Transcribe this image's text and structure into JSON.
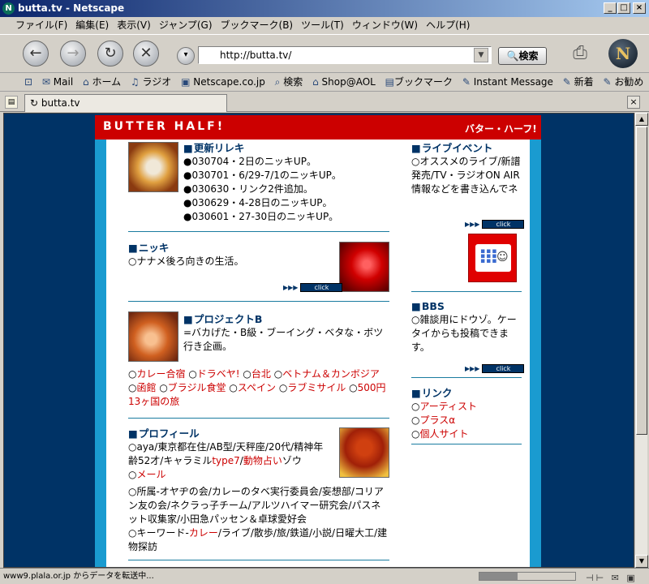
{
  "window": {
    "title": "butta.tv - Netscape",
    "app_icon": "N",
    "min": "_",
    "max": "□",
    "close": "×"
  },
  "menu": [
    "ファイル(F)",
    "編集(E)",
    "表示(V)",
    "ジャンプ(G)",
    "ブックマーク(B)",
    "ツール(T)",
    "ウィンドウ(W)",
    "ヘルプ(H)"
  ],
  "nav": {
    "back": "back-icon",
    "forward": "forward-icon",
    "reload": "reload-icon",
    "stop": "stop-icon",
    "url": "http://butta.tv/",
    "search_label": "検索"
  },
  "personal_toolbar": [
    {
      "icon": "home-tab-icon",
      "label": ""
    },
    {
      "icon": "mail-icon",
      "label": "Mail"
    },
    {
      "icon": "home-icon",
      "label": "ホーム"
    },
    {
      "icon": "radio-icon",
      "label": "ラジオ"
    },
    {
      "icon": "netscape-icon",
      "label": "Netscape.co.jp"
    },
    {
      "icon": "search-icon",
      "label": "検索"
    },
    {
      "icon": "shop-icon",
      "label": "Shop@AOL"
    },
    {
      "icon": "bookmark-icon",
      "label": "ブックマーク"
    },
    {
      "icon": "im-icon",
      "label": "Instant Message"
    },
    {
      "icon": "link-icon",
      "label": "新着"
    },
    {
      "icon": "link-icon",
      "label": "お勧め"
    }
  ],
  "tab": {
    "title": "butta.tv"
  },
  "page": {
    "logo_en": "BUTTER HALF!",
    "logo_jp": "バター・ハーフ!",
    "updates": {
      "heading": "更新リレキ",
      "items": [
        "030704・2日のニッキUP。",
        "030701・6/29-7/1のニッキUP。",
        "030630・リンク2件追加。",
        "030629・4-28日のニッキUP。",
        "030601・27-30日のニッキUP。"
      ]
    },
    "nikki": {
      "heading": "ニッキ",
      "text": "○ナナメ後ろ向きの生活。"
    },
    "project": {
      "heading": "プロジェクトB",
      "text": "=バカげた・B級・ブーイング・ベタな・ボツ行き企画。",
      "links": [
        {
          "prefix": "○",
          "label": "カレー合宿"
        },
        {
          "prefix": " ○",
          "label": "ドラベヤ!"
        },
        {
          "prefix": " ○",
          "label": "台北"
        },
        {
          "prefix": " ○",
          "label": "ベトナム＆カンボジア"
        },
        {
          "prefix": " ○",
          "label": "函館"
        },
        {
          "prefix": " ○",
          "label": "ブラジル食堂"
        },
        {
          "prefix": " ○",
          "label": "スペイン"
        },
        {
          "prefix": " ○",
          "label": "ラブミサイル"
        },
        {
          "prefix": " ○",
          "label": "500円13ヶ国の旅"
        }
      ]
    },
    "profile": {
      "heading": "プロフィール",
      "line1a": "○aya/東京都在住/AB型/天秤座/20代/精神年齢52才/キャラミル",
      "link_type7": "type7",
      "sep1": "/",
      "link_uranai": "動物占い",
      "line1b": "ゾウ",
      "mail_prefix": "○",
      "link_mail": "メール",
      "para2": "○所属-オヤヂの会/カレーのタベ実行委員会/妄想部/コリアン友の会/ネクラっ子チーム/アルツハイマー研究会/パスネット収集家/小田急パッセン＆卓球愛好会",
      "kw_prefix": "○キーワード-",
      "link_curry": "カレー",
      "kw_rest": "/ライブ/散歩/旅/鉄道/小説/日曜大工/建物探訪"
    },
    "live": {
      "heading": "ライブイベント",
      "text": "○オススメのライブ/新譜発売/TV・ラジオON AIR情報などを書き込んでネ"
    },
    "bbs": {
      "heading": "BBS",
      "text": "○雑談用にドウゾ。ケータイからも投稿できます。"
    },
    "links": {
      "heading": "リンク",
      "items": [
        {
          "prefix": "○",
          "label": "アーティスト"
        },
        {
          "prefix": "○",
          "label": "プラスα"
        },
        {
          "prefix": "○",
          "label": "個人サイト"
        }
      ]
    },
    "click_label": "click",
    "arrows": "▶▶▶"
  },
  "status": {
    "text": "www9.plala.or.jp からデータを転送中..."
  }
}
